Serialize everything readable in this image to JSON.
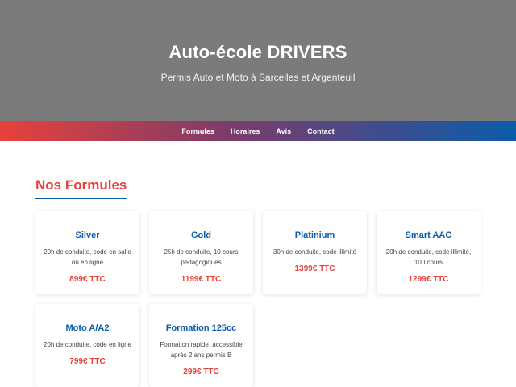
{
  "hero": {
    "title": "Auto-école DRIVERS",
    "subtitle": "Permis Auto et Moto à Sarcelles et Argenteuil"
  },
  "nav": {
    "items": [
      "Formules",
      "Horaires",
      "Avis",
      "Contact"
    ]
  },
  "section": {
    "title": "Nos Formules"
  },
  "formules": [
    {
      "title": "Silver",
      "desc": "20h de conduite, code en salle ou en ligne",
      "price": "899€ TTC"
    },
    {
      "title": "Gold",
      "desc": "25h de conduite, 10 cours pédagogiques",
      "price": "1199€ TTC"
    },
    {
      "title": "Platinium",
      "desc": "30h de conduite, code illimité",
      "price": "1399€ TTC"
    },
    {
      "title": "Smart AAC",
      "desc": "20h de conduite, code illimité, 100 cours",
      "price": "1299€ TTC"
    },
    {
      "title": "Moto A/A2",
      "desc": "20h de conduite, code en ligne",
      "price": "799€ TTC"
    },
    {
      "title": "Formation 125cc",
      "desc": "Formation rapide, accessible après 2 ans permis B",
      "price": "299€ TTC"
    }
  ],
  "colors": {
    "accent_red": "#e8413a",
    "accent_blue": "#0b5cab",
    "hero_bg": "#7b7b7b"
  }
}
